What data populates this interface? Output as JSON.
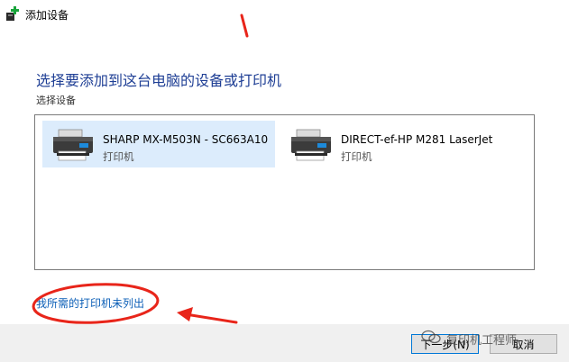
{
  "window": {
    "title": "添加设备",
    "icon": "printer-add-icon"
  },
  "main": {
    "heading": "选择要添加到这台电脑的设备或打印机",
    "sublabel": "选择设备",
    "devices": [
      {
        "name": "SHARP MX-M503N - SC663A10",
        "type": "打印机",
        "selected": true,
        "icon": "printer-icon"
      },
      {
        "name": "DIRECT-ef-HP M281 LaserJet",
        "type": "打印机",
        "selected": false,
        "icon": "printer-icon"
      }
    ],
    "link": "我所需的打印机未列出"
  },
  "footer": {
    "next_label": "下一步(N)",
    "cancel_label": "取消"
  },
  "watermark": {
    "text": "复印机工程师",
    "icon": "wechat-icon"
  },
  "colors": {
    "heading": "#1f3f95",
    "link": "#0c5fb7",
    "annotation": "#e8251a",
    "selection": "#dcecfc"
  }
}
